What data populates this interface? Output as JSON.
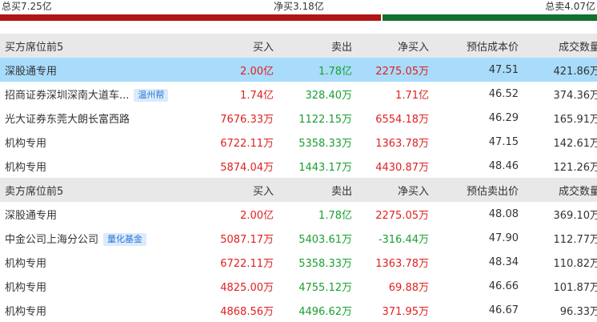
{
  "summary": {
    "total_buy": "总买7.25亿",
    "net_buy": "净买3.18亿",
    "total_sell": "总卖4.07亿"
  },
  "buy_section": {
    "headers": [
      "买方席位前5",
      "买入",
      "卖出",
      "净买入",
      "预估成本价",
      "成交数量"
    ],
    "rows": [
      {
        "name": "深股通专用",
        "tag": "",
        "buy": "2.00亿",
        "sell": "1.78亿",
        "net": "2275.05万",
        "price": "47.51",
        "volume": "421.86万"
      },
      {
        "name": "招商证券深圳深南大道车...",
        "tag": "温州帮",
        "buy": "1.74亿",
        "sell": "328.40万",
        "net": "1.71亿",
        "price": "46.52",
        "volume": "374.36万"
      },
      {
        "name": "光大证券东莞大朗长富西路",
        "tag": "",
        "buy": "7676.33万",
        "sell": "1122.15万",
        "net": "6554.18万",
        "price": "46.29",
        "volume": "165.91万"
      },
      {
        "name": "机构专用",
        "tag": "",
        "buy": "6722.11万",
        "sell": "5358.33万",
        "net": "1363.78万",
        "price": "47.15",
        "volume": "142.61万"
      },
      {
        "name": "机构专用",
        "tag": "",
        "buy": "5874.04万",
        "sell": "1443.17万",
        "net": "4430.87万",
        "price": "48.46",
        "volume": "121.26万"
      }
    ]
  },
  "sell_section": {
    "headers": [
      "卖方席位前5",
      "买入",
      "卖出",
      "净买入",
      "预估卖出价",
      "成交数量"
    ],
    "rows": [
      {
        "name": "深股通专用",
        "tag": "",
        "buy": "2.00亿",
        "sell": "1.78亿",
        "net": "2275.05万",
        "price": "48.08",
        "volume": "369.10万"
      },
      {
        "name": "中金公司上海分公司",
        "tag": "量化基金",
        "buy": "5087.17万",
        "sell": "5403.61万",
        "net": "-316.44万",
        "price": "47.90",
        "volume": "112.77万"
      },
      {
        "name": "机构专用",
        "tag": "",
        "buy": "6722.11万",
        "sell": "5358.33万",
        "net": "1363.78万",
        "price": "48.34",
        "volume": "110.82万"
      },
      {
        "name": "机构专用",
        "tag": "",
        "buy": "4825.00万",
        "sell": "4755.12万",
        "net": "69.88万",
        "price": "46.66",
        "volume": "101.87万"
      },
      {
        "name": "机构专用",
        "tag": "",
        "buy": "4868.56万",
        "sell": "4496.62万",
        "net": "371.95万",
        "price": "46.67",
        "volume": "96.33万"
      }
    ]
  },
  "colors": {
    "buy_bar": "#b01616",
    "sell_bar": "#11712e",
    "positive": "#e0201f",
    "negative": "#1aa030",
    "highlight": "#a8dcfa",
    "header_bg": "#e8e8e8"
  }
}
